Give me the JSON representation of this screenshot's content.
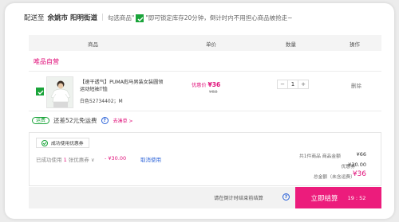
{
  "shipping": {
    "prefix": "配送至",
    "location": "余姚市 阳明街道",
    "tip_before": "勾选商品\"",
    "tip_after": "\"即可锁定库存20分钟，倒计时内不用担心商品被抢走~"
  },
  "table_header": {
    "product": "商品",
    "unit_price": "单价",
    "quantity": "数量",
    "actions": "操作"
  },
  "shop": {
    "name": "唯品自营"
  },
  "product": {
    "name": "【速干透气】PUMA彪马男装女装圆领运动短袖T恤",
    "spec": "白色52734402；M",
    "price_label": "优惠价",
    "price": "¥36",
    "original_price": "¥69",
    "quantity": "1",
    "minus": "−",
    "plus": "+",
    "delete": "删除",
    "checked": true
  },
  "free_shipping": {
    "badge": "运费",
    "text": "还差52元免运费",
    "help": "?",
    "add_more": "去凑单 >"
  },
  "coupon": {
    "tab_label": "成功使用优惠券",
    "used_prefix": "已成功使用",
    "used_count": "1",
    "used_suffix": "张优惠券 ∨",
    "amount": "- ¥30.00",
    "cancel": "取消使用"
  },
  "summary": {
    "items_label": "共1件商品  商品金额",
    "items_value": "¥66",
    "discount_label": "优惠券",
    "discount_value": "-¥30.00",
    "total_label": "总金额（未含运费）",
    "total_value": "¥36"
  },
  "footer": {
    "countdown_tip": "请在倒计时结束前结算",
    "help": "?",
    "checkout": "立即结算",
    "timer": "19 : 52"
  },
  "colors": {
    "accent": "#e0107a",
    "checkout_bg": "#ec1c7c",
    "check_green": "#1aa43a",
    "link_blue": "#2b62d8"
  }
}
